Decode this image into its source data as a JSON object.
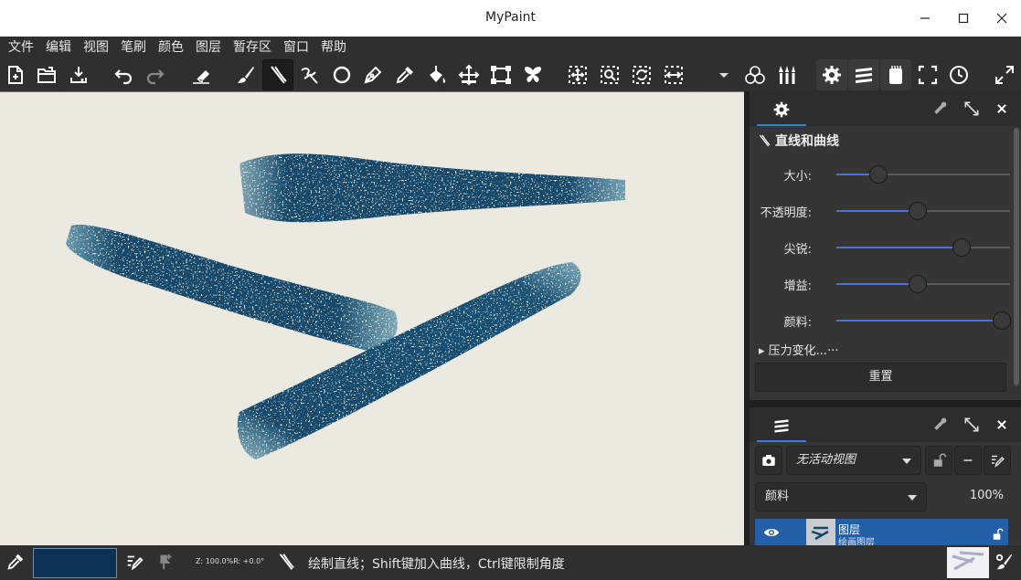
{
  "window": {
    "title": "MyPaint"
  },
  "menu": [
    "文件",
    "编辑",
    "视图",
    "笔刷",
    "颜色",
    "图层",
    "暂存区",
    "窗口",
    "帮助"
  ],
  "toolbar": {
    "icons": [
      "new-document",
      "open-file",
      "save",
      "undo",
      "redo",
      "eraser-mode",
      "freehand-brush",
      "lines-and-curves",
      "connected-lines",
      "ellipse",
      "inking",
      "color-picker",
      "fill",
      "move-layer",
      "frame",
      "symmetry",
      "pan-view",
      "zoom-view",
      "rotate-view",
      "mirror-view",
      "more-menu",
      "color-panels",
      "brush-panels",
      "settings",
      "layers",
      "scratchpad",
      "fullscreen",
      "history",
      "expand"
    ]
  },
  "tool_options": {
    "title": "直线和曲线",
    "sliders": [
      {
        "label": "大小:",
        "value": 0.24
      },
      {
        "label": "不透明度:",
        "value": 0.47
      },
      {
        "label": "尖锐:",
        "value": 0.72
      },
      {
        "label": "增益:",
        "value": 0.47
      },
      {
        "label": "颜料:",
        "value": 0.95
      }
    ],
    "expander_label": "压力变化...",
    "expander_ellipsis": "···",
    "reset_label": "重置"
  },
  "layers_panel": {
    "view_combo": "无活动视图",
    "mode_combo": "颜料",
    "opacity": "100%",
    "layer": {
      "name": "图层",
      "type": "绘画图层"
    }
  },
  "status": {
    "zoom_text": "Z: 100.0%R: +0.0°",
    "message": "绘制直线；Shift键加入曲线，Ctrl键限制角度",
    "current_color": "#0c3152"
  },
  "colors": {
    "stroke": "#15496b",
    "accent": "#3d7ad6",
    "canvas": "#eceadf"
  }
}
